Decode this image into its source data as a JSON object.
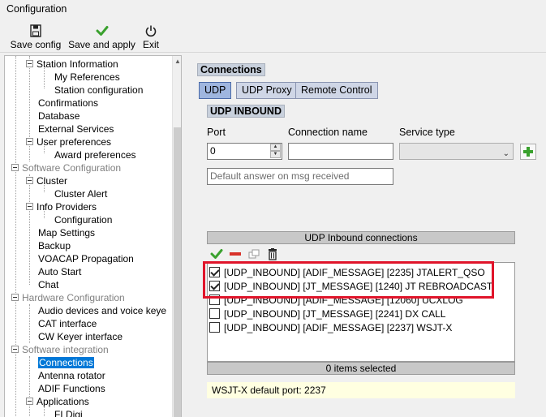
{
  "window": {
    "title": "Configuration"
  },
  "toolbar": {
    "save_config": "Save config",
    "save_apply": "Save and apply",
    "exit": "Exit"
  },
  "tree": {
    "items": [
      {
        "label": "Station Information",
        "level": 1,
        "expander": true
      },
      {
        "label": "My References",
        "level": 2
      },
      {
        "label": "Station configuration",
        "level": 2
      },
      {
        "label": "Confirmations",
        "level": 1
      },
      {
        "label": "Database",
        "level": 1
      },
      {
        "label": "External Services",
        "level": 1
      },
      {
        "label": "User preferences",
        "level": 1,
        "expander": true
      },
      {
        "label": "Award preferences",
        "level": 2
      },
      {
        "label": "Software Configuration",
        "level": 0,
        "expander": true,
        "group": true
      },
      {
        "label": "Cluster",
        "level": 1,
        "expander": true
      },
      {
        "label": "Cluster Alert",
        "level": 2
      },
      {
        "label": "Info Providers",
        "level": 1,
        "expander": true
      },
      {
        "label": "Configuration",
        "level": 2
      },
      {
        "label": "Map Settings",
        "level": 1
      },
      {
        "label": "Backup",
        "level": 1
      },
      {
        "label": "VOACAP Propagation",
        "level": 1
      },
      {
        "label": "Auto Start",
        "level": 1
      },
      {
        "label": "Chat",
        "level": 1
      },
      {
        "label": "Hardware Configuration",
        "level": 0,
        "expander": true,
        "group": true
      },
      {
        "label": "Audio devices and voice keye",
        "level": 1
      },
      {
        "label": "CAT interface",
        "level": 1
      },
      {
        "label": "CW Keyer interface",
        "level": 1
      },
      {
        "label": "Software integration",
        "level": 0,
        "expander": true,
        "group": true
      },
      {
        "label": "Connections",
        "level": 1,
        "selected": true
      },
      {
        "label": "Antenna rotator",
        "level": 1
      },
      {
        "label": "ADIF Functions",
        "level": 1
      },
      {
        "label": "Applications",
        "level": 1,
        "expander": true
      },
      {
        "label": "FLDigi",
        "level": 2
      }
    ]
  },
  "panel": {
    "heading": "Connections",
    "tabs": [
      "UDP",
      "UDP Proxy",
      "Remote Control"
    ],
    "active_tab": "UDP",
    "section": "UDP INBOUND",
    "port_label": "Port",
    "port_value": "0",
    "name_label": "Connection name",
    "name_value": "",
    "service_label": "Service type",
    "service_value": "",
    "default_answer_placeholder": "Default answer on msg received",
    "grid_header": "UDP Inbound connections",
    "connections": [
      {
        "text": "[UDP_INBOUND] [ADIF_MESSAGE] [2235] JTALERT_QSO",
        "checked": true
      },
      {
        "text": "[UDP_INBOUND] [JT_MESSAGE] [1240] JT REBROADCAST",
        "checked": true
      },
      {
        "text": "[UDP_INBOUND] [ADIF_MESSAGE] [12060] UCXLOG",
        "checked": false
      },
      {
        "text": "[UDP_INBOUND] [JT_MESSAGE] [2241] DX CALL",
        "checked": false
      },
      {
        "text": "[UDP_INBOUND] [ADIF_MESSAGE] [2237] WSJT-X",
        "checked": false
      }
    ],
    "status": "0 items selected",
    "note": "WSJT-X default port: 2237"
  },
  "colors": {
    "highlight": "#e0142a",
    "selection": "#0078d7",
    "note_bg": "#ffffe1"
  },
  "icons": {
    "save_config": "floppy-disk-icon",
    "save_apply": "green-check-icon",
    "exit": "power-icon",
    "add": "green-plus-icon",
    "check_all": "green-check-icon",
    "uncheck": "red-minus-icon",
    "copy": "copy-icon",
    "delete": "trash-icon"
  }
}
